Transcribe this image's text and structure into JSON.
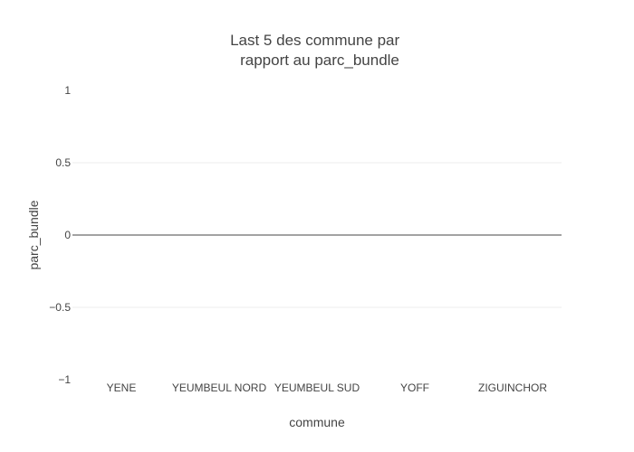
{
  "chart_data": {
    "type": "bar",
    "title_lines": [
      "Last 5 des commune par",
      "rapport au parc_bundle"
    ],
    "xlabel": "commune",
    "ylabel": "parc_bundle",
    "categories": [
      "YENE",
      "YEUMBEUL NORD",
      "YEUMBEUL SUD",
      "YOFF",
      "ZIGUINCHOR"
    ],
    "values": [
      0,
      0,
      0,
      0,
      0
    ],
    "ylim": [
      -1,
      1
    ],
    "yticks": [
      -1,
      -0.5,
      0,
      0.5,
      1
    ],
    "ytick_labels": [
      "−1",
      "−0.5",
      "0",
      "0.5",
      "1"
    ],
    "grid": true,
    "legend": "none",
    "colors": {
      "grid": "#eeeeee",
      "zeroline": "#444444",
      "text": "#444444",
      "bar": "#636efa"
    }
  }
}
